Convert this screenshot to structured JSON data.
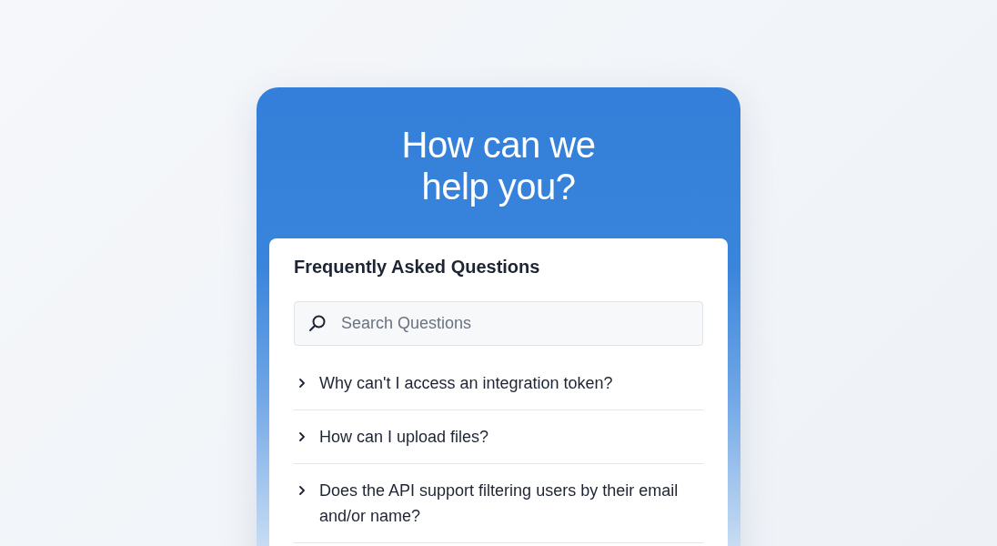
{
  "hero": {
    "title_lines": [
      "How can we",
      "help you?"
    ]
  },
  "faq": {
    "title": "Frequently Asked Questions",
    "search": {
      "placeholder": "Search Questions"
    },
    "items": [
      {
        "question": "Why can't I access an integration token?",
        "expanded": false
      },
      {
        "question": "How can I upload files?",
        "expanded": false
      },
      {
        "question": "Does the API support filtering users by their email and/or name?",
        "expanded": false
      }
    ]
  }
}
